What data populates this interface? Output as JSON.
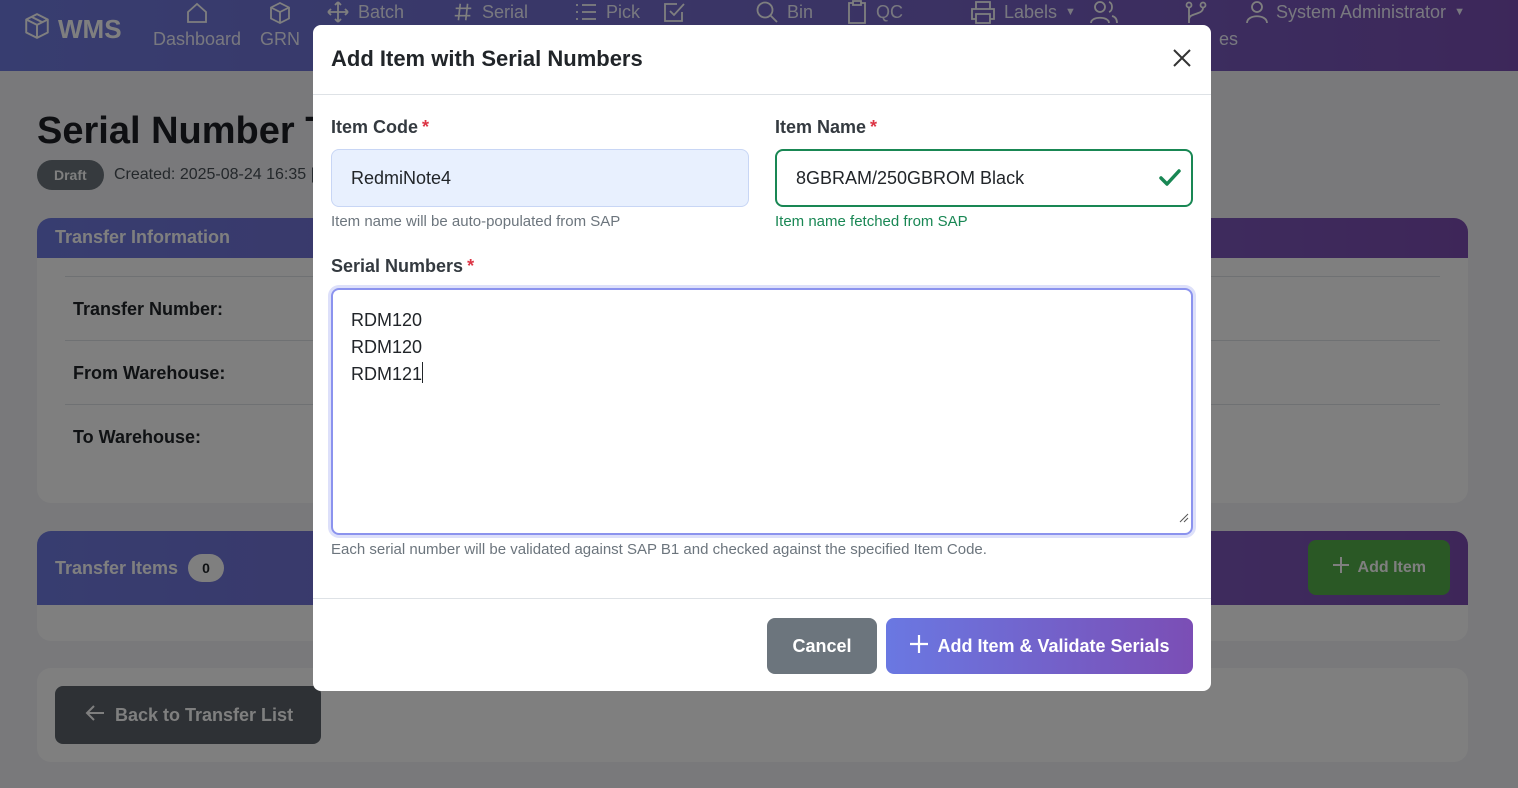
{
  "nav": {
    "brand": "WMS",
    "items": [
      {
        "label": "Dashboard",
        "icon": "house-icon"
      },
      {
        "label": "GRN",
        "icon": "box-icon"
      },
      {
        "label": "Batch",
        "icon": "arrows-move-icon"
      },
      {
        "label": "Serial",
        "icon": "hash-icon"
      },
      {
        "label": "Pick",
        "icon": "list-icon"
      },
      {
        "label": "",
        "icon": "check-square-icon"
      },
      {
        "label": "Bin",
        "icon": "search-icon"
      },
      {
        "label": "QC",
        "icon": "clipboard-icon"
      },
      {
        "label": "Labels",
        "icon": "printer-icon"
      },
      {
        "label": "",
        "icon": "users-icon"
      },
      {
        "label": "es",
        "icon": "branch-icon"
      }
    ],
    "user": "System Administrator"
  },
  "page": {
    "title": "Serial Number Tr",
    "status": "Draft",
    "created": "Created: 2025-08-24 16:35 |"
  },
  "info_card": {
    "header": "Transfer Information",
    "labels": [
      "Transfer Number:",
      "From Warehouse:",
      "To Warehouse:"
    ]
  },
  "items_card": {
    "header": "Transfer Items",
    "count": "0",
    "add_button": "Add Item"
  },
  "back_button": "Back to Transfer List",
  "modal": {
    "title": "Add Item with Serial Numbers",
    "item_code": {
      "label": "Item Code",
      "required_mark": "*",
      "value": "RedmiNote4",
      "help": "Item name will be auto-populated from SAP"
    },
    "item_name": {
      "label": "Item Name",
      "required_mark": "*",
      "value": "8GBRAM/250GBROM Black",
      "help": "Item name fetched from SAP"
    },
    "serials": {
      "label": "Serial Numbers",
      "required_mark": "*",
      "lines": [
        "RDM120",
        "RDM120",
        "RDM121"
      ],
      "help": "Each serial number will be validated against SAP B1 and checked against the specified Item Code."
    },
    "cancel_label": "Cancel",
    "submit_label": "Add Item & Validate Serials"
  },
  "colors": {
    "nav_gradient_start": "#6f7be0",
    "nav_gradient_end": "#7b4fb5",
    "success": "#198754",
    "required": "#dc3545",
    "secondary": "#6c757d",
    "add_item_green": "#55b04a"
  }
}
